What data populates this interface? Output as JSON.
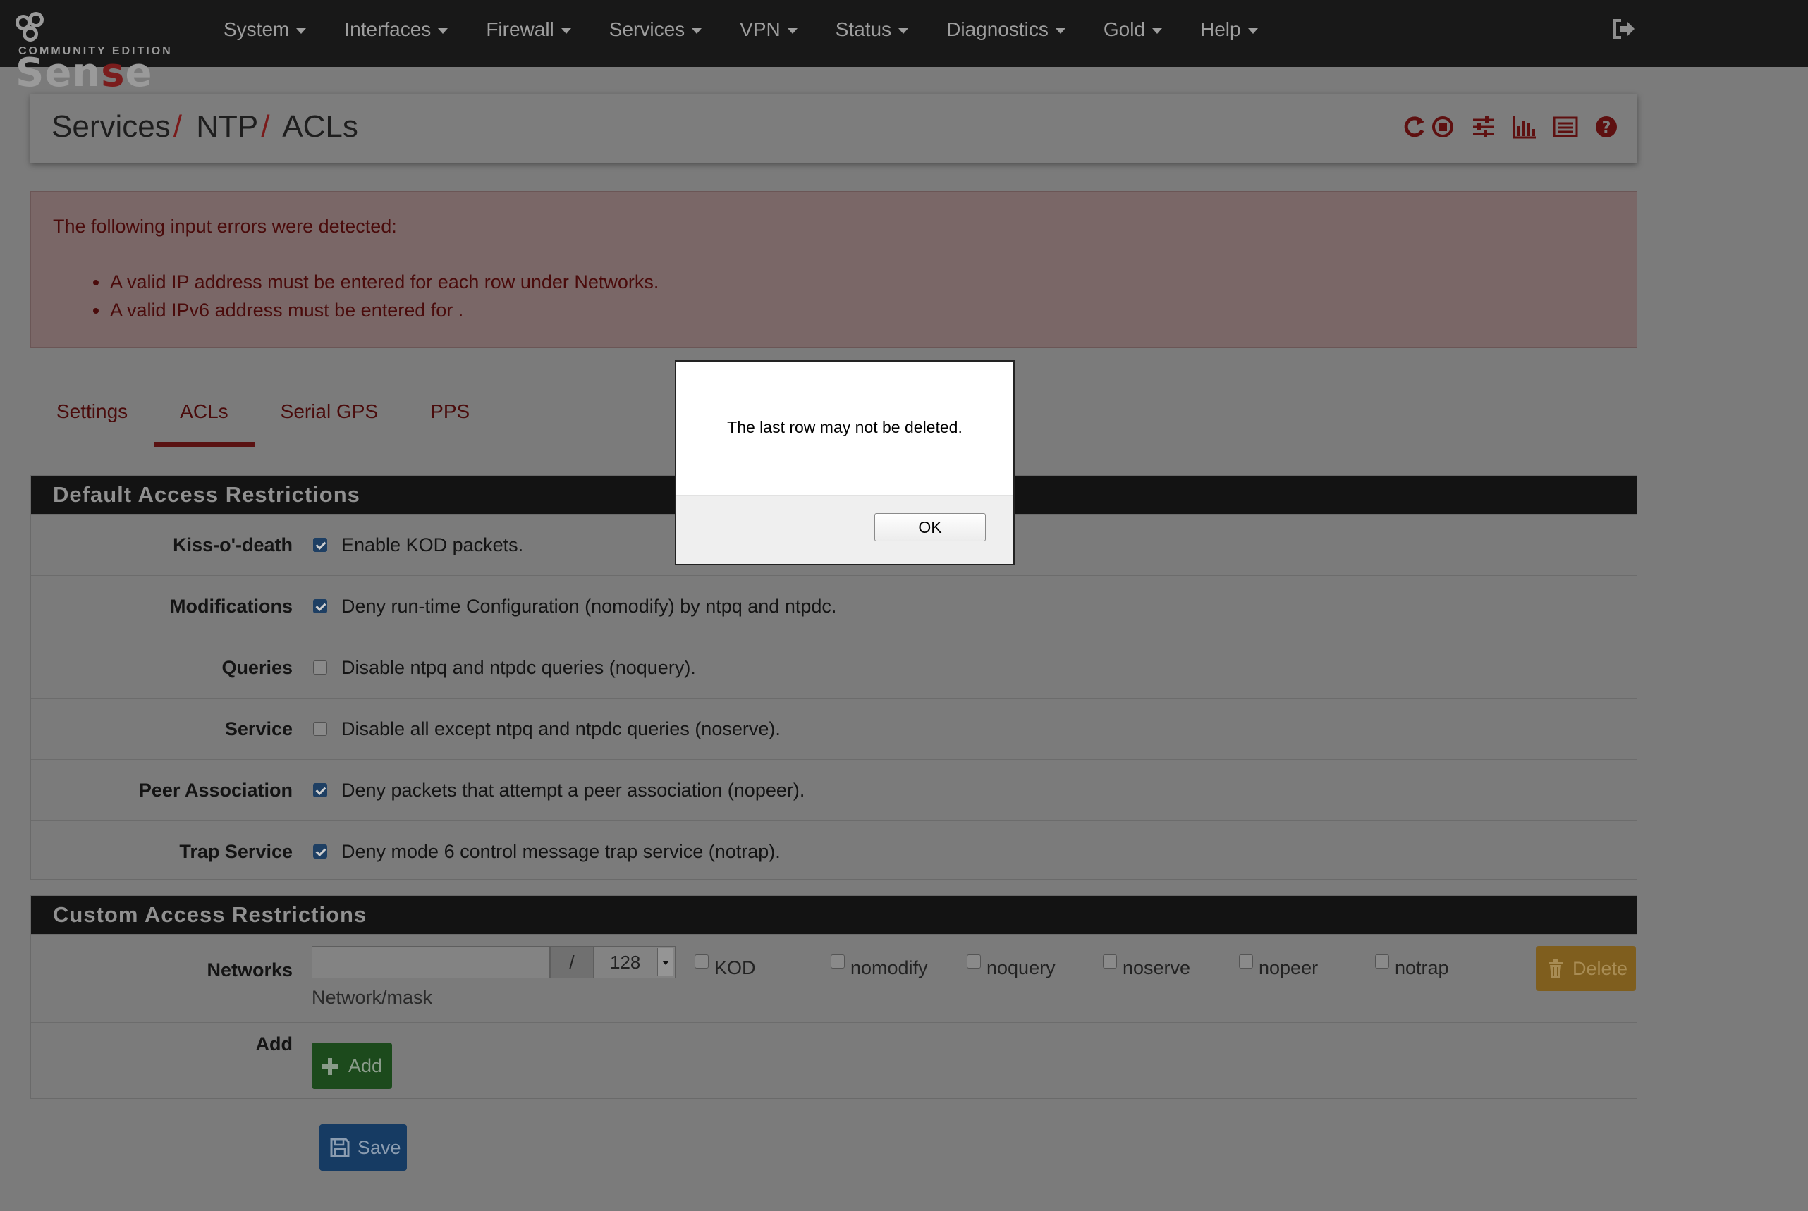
{
  "brand": {
    "name_pre": "Sen",
    "name_mid": "s",
    "name_post": "e",
    "edition": "COMMUNITY EDITION"
  },
  "nav": {
    "items": [
      {
        "label": "System"
      },
      {
        "label": "Interfaces"
      },
      {
        "label": "Firewall"
      },
      {
        "label": "Services"
      },
      {
        "label": "VPN"
      },
      {
        "label": "Status"
      },
      {
        "label": "Diagnostics"
      },
      {
        "label": "Gold"
      },
      {
        "label": "Help"
      }
    ],
    "logout_icon": "logout-icon"
  },
  "breadcrumb": {
    "level1": "Services",
    "level2": "NTP",
    "level3": "ACLs",
    "separator": "/"
  },
  "header_icons": [
    "restart-icon",
    "stop-icon",
    "settings-sliders-icon",
    "chart-icon",
    "log-list-icon",
    "help-icon"
  ],
  "alert": {
    "title": "The following input errors were detected:",
    "errors": [
      "A valid IP address must be entered for each row under Networks.",
      "A valid IPv6 address must be entered for ."
    ]
  },
  "tabs": [
    {
      "label": "Settings",
      "active": false
    },
    {
      "label": "ACLs",
      "active": true
    },
    {
      "label": "Serial GPS",
      "active": false
    },
    {
      "label": "PPS",
      "active": false
    }
  ],
  "default_panel": {
    "title": "Default Access Restrictions",
    "rows": [
      {
        "label": "Kiss-o'-death",
        "text": "Enable KOD packets.",
        "checked": true
      },
      {
        "label": "Modifications",
        "text": "Deny run-time Configuration (nomodify) by ntpq and ntpdc.",
        "checked": true
      },
      {
        "label": "Queries",
        "text": "Disable ntpq and ntpdc queries (noquery).",
        "checked": false
      },
      {
        "label": "Service",
        "text": "Disable all except ntpq and ntpdc queries (noserve).",
        "checked": false
      },
      {
        "label": "Peer Association",
        "text": "Deny packets that attempt a peer association (nopeer).",
        "checked": true
      },
      {
        "label": "Trap Service",
        "text": "Deny mode 6 control message trap service (notrap).",
        "checked": true
      }
    ]
  },
  "custom_panel": {
    "title": "Custom Access Restrictions",
    "networks_label": "Networks",
    "network_value": "",
    "slash": "/",
    "mask_value": "128",
    "help": "Network/mask",
    "options": [
      "KOD",
      "nomodify",
      "noquery",
      "noserve",
      "nopeer",
      "notrap"
    ],
    "delete_label": "Delete",
    "add_row_label": "Add",
    "add_button_label": "Add"
  },
  "save_label": "Save",
  "modal": {
    "message": "The last row may not be deleted.",
    "ok_label": "OK"
  },
  "colors": {
    "navbar": "#181818",
    "accent_red": "#7a1a1a",
    "panel_heading": "#131313",
    "add_green": "#1c4a1c",
    "save_blue": "#163b63",
    "delete_orange": "#7f5e1e"
  }
}
